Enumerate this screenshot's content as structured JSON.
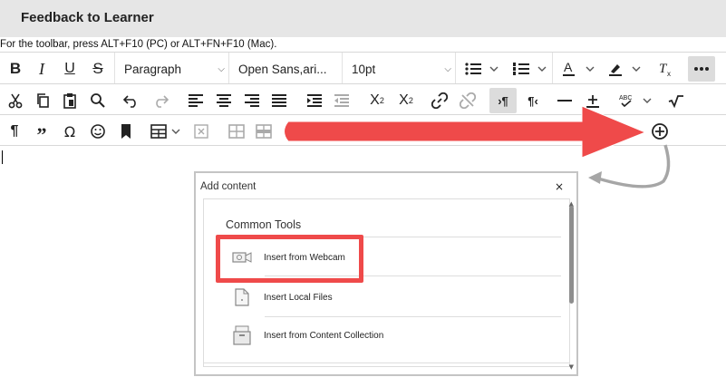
{
  "header": {
    "title": "Feedback to Learner"
  },
  "hint": "For the toolbar, press ALT+F10 (PC) or ALT+FN+F10 (Mac).",
  "toolbar": {
    "block_format": "Paragraph",
    "font_family": "Open Sans,ari...",
    "font_size": "10pt"
  },
  "dialog": {
    "title": "Add content",
    "close": "×",
    "section": "Common Tools",
    "items": [
      {
        "label": "Insert from Webcam",
        "icon": "webcam-icon"
      },
      {
        "label": "Insert Local Files",
        "icon": "file-icon"
      },
      {
        "label": "Insert from Content Collection",
        "icon": "content-collection-icon"
      }
    ]
  },
  "annotations": {
    "arrow_color": "#ef4a4a",
    "highlight_color": "#ef4a4a",
    "curved_arrow_color": "#a6a6a6"
  }
}
